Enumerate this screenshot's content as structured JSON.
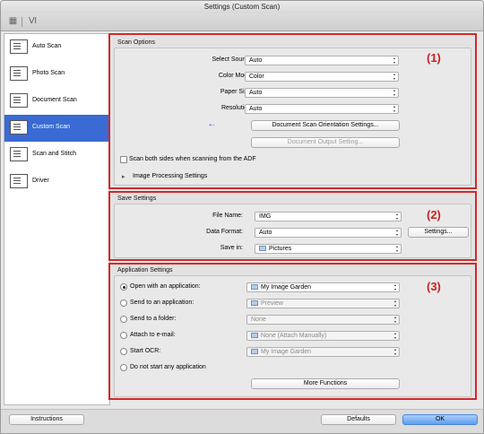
{
  "window": {
    "title": "Settings (Custom Scan)"
  },
  "toolbar": {
    "icons": [
      "scan-icon",
      "settings-icon"
    ]
  },
  "sidebar": {
    "items": [
      {
        "label": "Auto Scan",
        "icon": "auto-scan-icon",
        "selected": false
      },
      {
        "label": "Photo Scan",
        "icon": "photo-scan-icon",
        "selected": false
      },
      {
        "label": "Document Scan",
        "icon": "document-scan-icon",
        "selected": false
      },
      {
        "label": "Custom Scan",
        "icon": "custom-scan-icon",
        "selected": true
      },
      {
        "label": "Scan and Stitch",
        "icon": "scan-stitch-icon",
        "selected": false
      },
      {
        "label": "Driver",
        "icon": "driver-icon",
        "selected": false
      }
    ]
  },
  "scan_options": {
    "title": "Scan Options",
    "number": "(1)",
    "select_source_label": "Select Source:",
    "select_source": "Auto",
    "color_mode_label": "Color Mode:",
    "color_mode": "Color",
    "paper_size_label": "Paper Size:",
    "paper_size": "Auto",
    "resolution_label": "Resolution:",
    "resolution": "Auto",
    "orientation_btn": "Document Scan Orientation Settings...",
    "output_btn": "Document Output Setting...",
    "both_sides": "Scan both sides when scanning from the ADF",
    "image_processing": "Image Processing Settings"
  },
  "save_settings": {
    "title": "Save Settings",
    "number": "(2)",
    "file_name_label": "File Name:",
    "file_name": "IMG",
    "data_format_label": "Data Format:",
    "data_format": "Auto",
    "settings_btn": "Settings...",
    "save_in_label": "Save in:",
    "save_in": "Pictures"
  },
  "app_settings": {
    "title": "Application Settings",
    "number": "(3)",
    "options": [
      {
        "label": "Open with an application:",
        "value": "My Image Garden",
        "selected": true,
        "enabled": true
      },
      {
        "label": "Send to an application:",
        "value": "Preview",
        "selected": false,
        "enabled": false
      },
      {
        "label": "Send to a folder:",
        "value": "None",
        "selected": false,
        "enabled": false
      },
      {
        "label": "Attach to e-mail:",
        "value": "None (Attach Manually)",
        "selected": false,
        "enabled": false
      },
      {
        "label": "Start OCR:",
        "value": "My Image Garden",
        "selected": false,
        "enabled": false
      },
      {
        "label": "Do not start any application",
        "value": "",
        "selected": false,
        "enabled": false
      }
    ],
    "more_functions": "More Functions"
  },
  "footer": {
    "instructions": "Instructions",
    "defaults": "Defaults",
    "ok": "OK"
  },
  "colors": {
    "selection": "#3a6ad3",
    "highlight_border": "#d12a2a",
    "number_red": "#cc1f1f",
    "ok_button": "#5e9ef0"
  }
}
